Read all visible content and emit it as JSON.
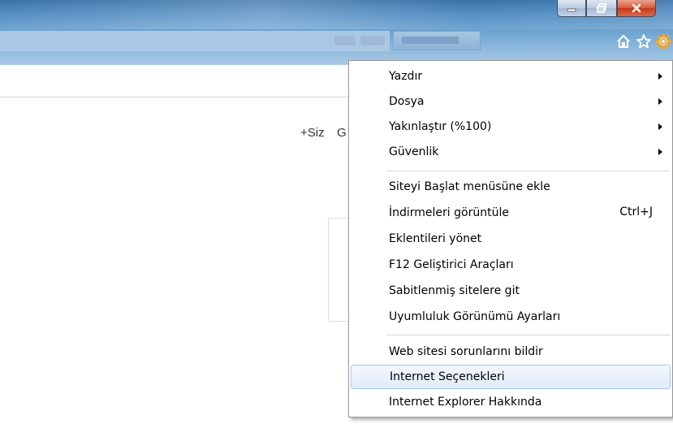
{
  "toolbar": {
    "home_icon": "home-icon",
    "favorites_icon": "star-icon",
    "tools_icon": "gear-icon"
  },
  "page": {
    "plus_siz": "+Siz",
    "partial_g": "G"
  },
  "menu": {
    "items": [
      {
        "label": "Yazdır",
        "submenu": true
      },
      {
        "label": "Dosya",
        "submenu": true
      },
      {
        "label": "Yakınlaştır (%100)",
        "submenu": true
      },
      {
        "label": "Güvenlik",
        "submenu": true
      },
      {
        "label": "Siteyi Başlat menüsüne ekle"
      },
      {
        "label": "İndirmeleri görüntüle",
        "shortcut": "Ctrl+J"
      },
      {
        "label": "Eklentileri yönet"
      },
      {
        "label": "F12 Geliştirici Araçları"
      },
      {
        "label": "Sabitlenmiş sitelere git"
      },
      {
        "label": "Uyumluluk Görünümü Ayarları"
      },
      {
        "label": "Web sitesi sorunlarını bildir"
      },
      {
        "label": "Internet Seçenekleri",
        "highlighted": true
      },
      {
        "label": "Internet Explorer Hakkında"
      }
    ]
  },
  "colors": {
    "titlebar": "#4a86bf",
    "close_button": "#c43a1a",
    "menu_highlight": "#e1ebfa"
  }
}
